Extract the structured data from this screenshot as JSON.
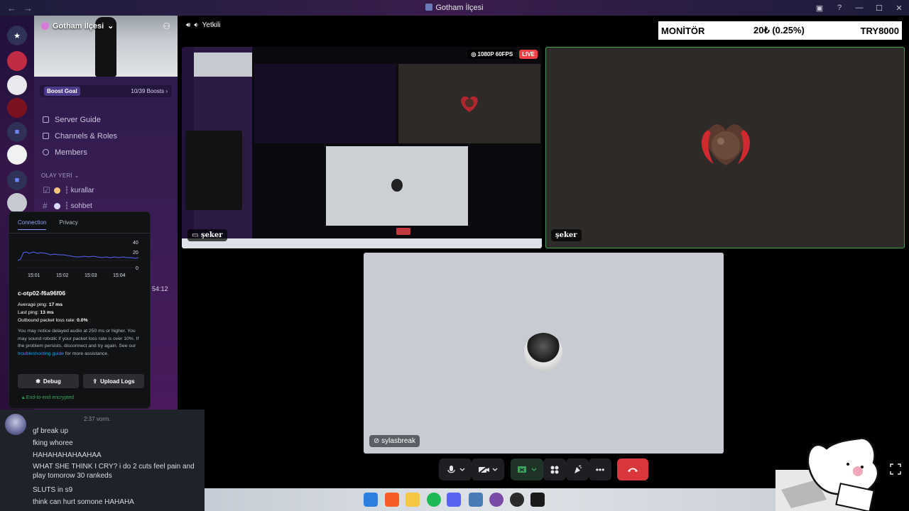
{
  "window": {
    "title": "Gotham İlçesi"
  },
  "server": {
    "name": "Gotham İlçesi",
    "boost_goal_label": "Boost Goal",
    "boost_progress": "10/39 Boosts"
  },
  "sidebar": {
    "links": [
      {
        "label": "Server Guide",
        "icon": "map-icon"
      },
      {
        "label": "Channels & Roles",
        "icon": "list-icon"
      },
      {
        "label": "Members",
        "icon": "members-icon"
      }
    ],
    "category": "OLAY YERİ",
    "channels": [
      {
        "label": "┆ kurallar",
        "icon": "checkbox-icon"
      },
      {
        "label": "┆ sohbet",
        "icon": "hash-icon"
      }
    ],
    "hidden_time": "54:12"
  },
  "connection": {
    "tabs": [
      "Connection",
      "Privacy"
    ],
    "active_tab": "Connection",
    "graph": {
      "y_ticks": [
        "40",
        "20",
        "0"
      ],
      "x_ticks": [
        "15:01",
        "15:02",
        "15:03",
        "15:04"
      ]
    },
    "server_id": "c-otp02-f6a96f06",
    "avg_ping_label": "Average ping:",
    "avg_ping_value": "17 ms",
    "last_ping_label": "Last ping:",
    "last_ping_value": "13 ms",
    "packet_loss_label": "Outbound packet loss rate:",
    "packet_loss_value": "0.0%",
    "note_part1": "You may notice delayed audio at 250 ms or higher. You may sound robotic if your packet loss rate is over 10%. If the problem persists, disconnect and try again. See our ",
    "note_link": "troubleshooting guide",
    "note_part2": " for more assistance.",
    "debug_label": "Debug",
    "upload_label": "Upload Logs",
    "encrypted_label": "End-to-end encrypted"
  },
  "chat": {
    "username": "",
    "time": "2:37 vorm.",
    "messages": [
      "gf break up",
      "fking whoree",
      "HAHAHAHAHAAHAA",
      "WHAT SHE THINK I CRY?  i do 2 cuts feel pain and play tomorow 30 rankeds",
      "SLUTS in s9",
      "think can hurt somone HAHAHA"
    ]
  },
  "voice": {
    "channel_label": "Yetkili"
  },
  "monitor": {
    "label": "MONİTÖR",
    "value": "20₺ (0.25%)",
    "goal": "TRY8000"
  },
  "tiles": {
    "stream": {
      "name": "şeker",
      "quality": "1080P 60FPS",
      "live": "LIVE"
    },
    "camera": {
      "name": "şeker"
    },
    "user": {
      "name": "sylasbreak"
    }
  },
  "colors": {
    "accent": "#5865f2",
    "live_red": "#ed4245",
    "speaking_green": "#43a25a",
    "hangup": "#da373c"
  }
}
